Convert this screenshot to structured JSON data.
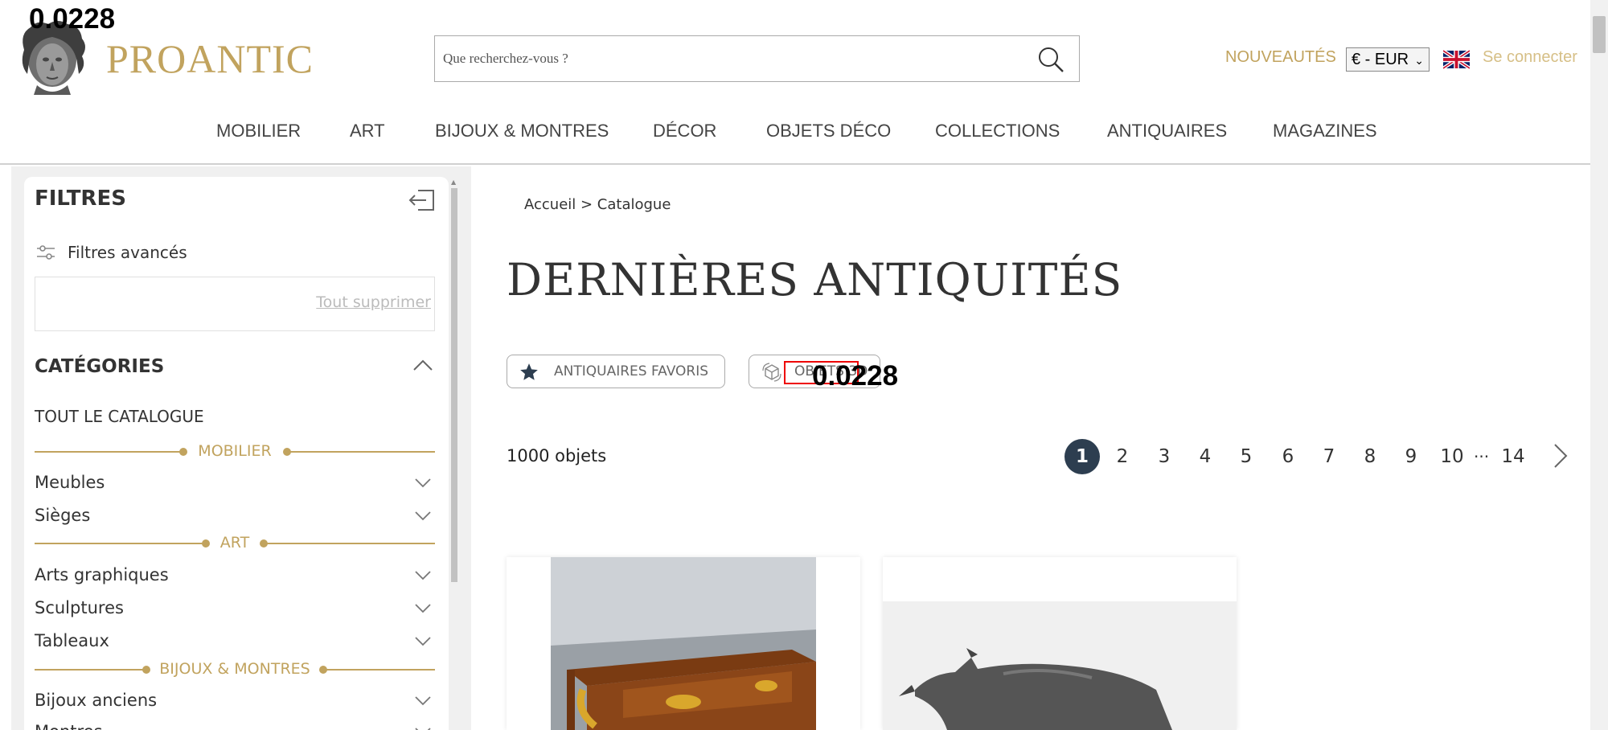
{
  "overlay": {
    "score_top": "0.0228",
    "score_mid": "0.0228"
  },
  "header": {
    "brand": "PROANTIC",
    "search_placeholder": "Que recherchez-vous ?",
    "new_label": "NOUVEAUTÉS",
    "currency": "€ - EUR",
    "login_label": "Se connecter"
  },
  "nav": [
    "MOBILIER",
    "ART",
    "BIJOUX & MONTRES",
    "DÉCOR",
    "OBJETS DÉCO",
    "COLLECTIONS",
    "ANTIQUAIRES",
    "MAGAZINES"
  ],
  "sidebar": {
    "title": "FILTRES",
    "advanced": "Filtres avancés",
    "clear_all": "Tout supprimer",
    "categories_title": "CATÉGORIES",
    "all_catalog": "TOUT LE CATALOGUE",
    "groups": [
      {
        "label": "MOBILIER",
        "items": [
          "Meubles",
          "Sièges"
        ]
      },
      {
        "label": "ART",
        "items": [
          "Arts graphiques",
          "Sculptures",
          "Tableaux"
        ]
      },
      {
        "label": "BIJOUX & MONTRES",
        "items": [
          "Bijoux anciens",
          "Montres"
        ]
      }
    ]
  },
  "main": {
    "breadcrumb": "Accueil > Catalogue",
    "title": "DERNIÈRES ANTIQUITÉS",
    "pill_favorites": "ANTIQUAIRES FAVORIS",
    "pill_objects": "OBJETS 3D",
    "count": "1000 objets",
    "pages": [
      "1",
      "2",
      "3",
      "4",
      "5",
      "6",
      "7",
      "8",
      "9",
      "10",
      "14"
    ],
    "current_page": "1",
    "ellipsis": "..."
  },
  "colors": {
    "gold": "#c1a35e",
    "active_page": "#2d3e50",
    "highlight": "#e00000"
  }
}
